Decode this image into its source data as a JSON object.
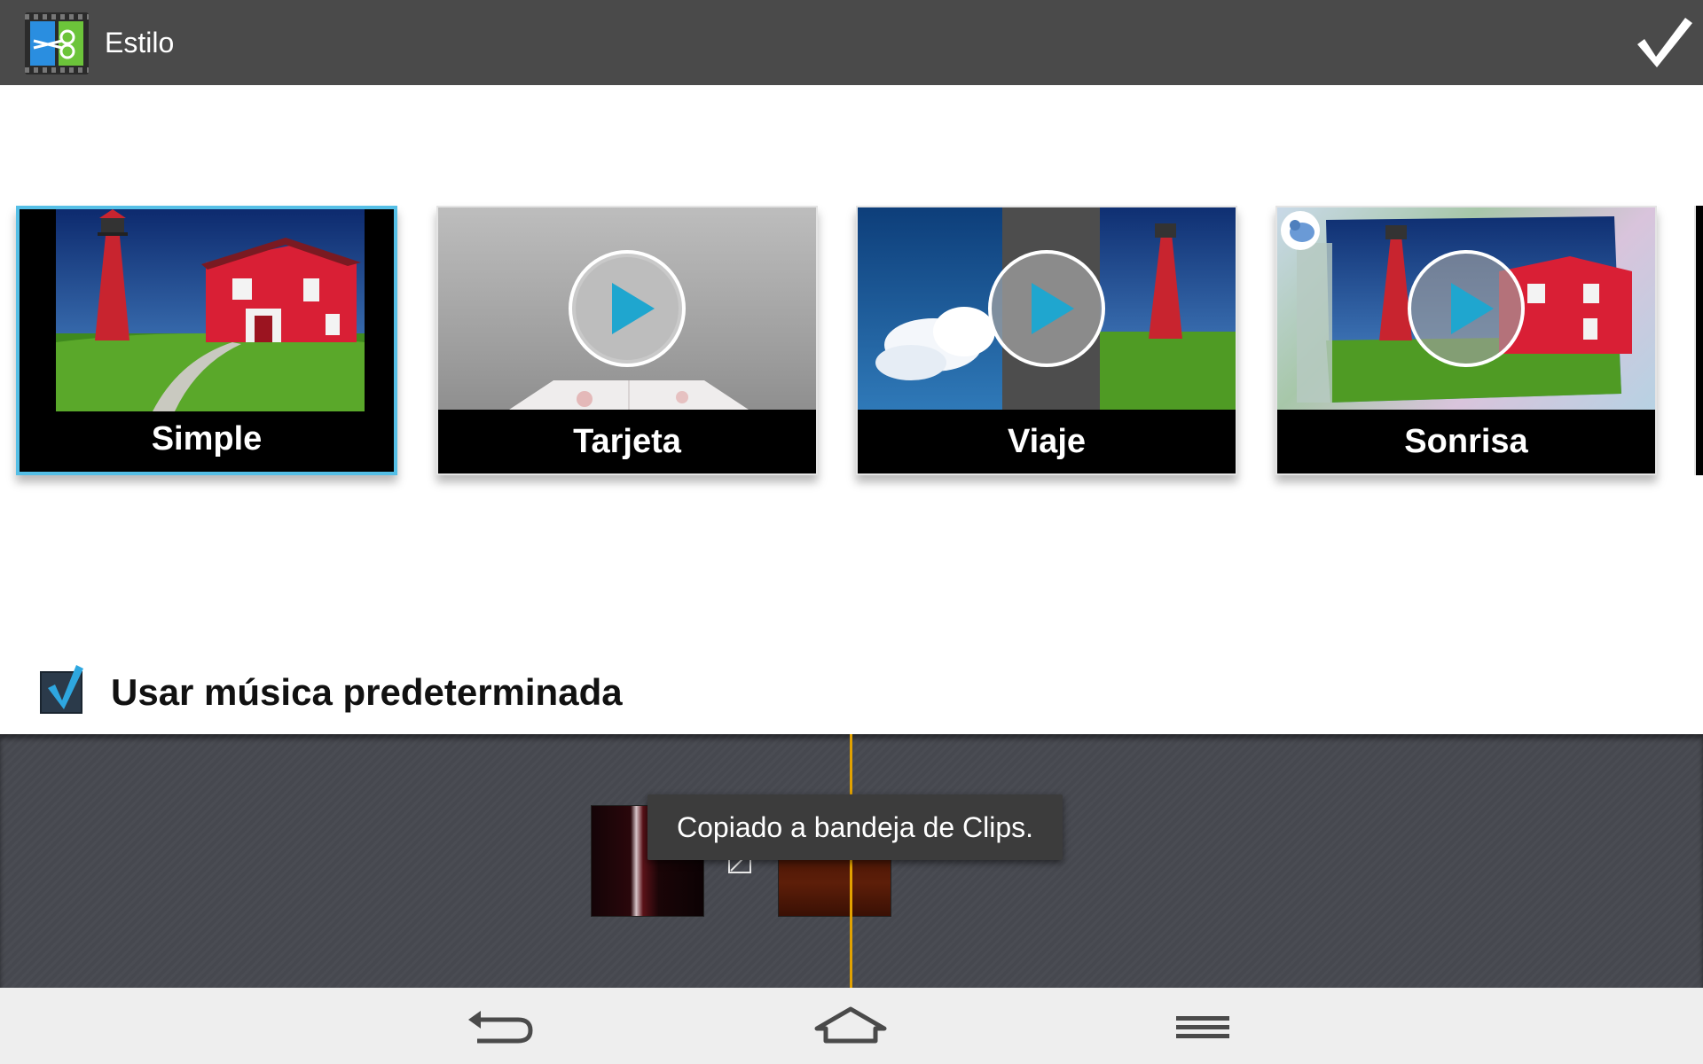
{
  "action_bar": {
    "title": "Estilo",
    "app_icon": "video-editor-app-icon",
    "confirm_icon": "checkmark-icon"
  },
  "styles": [
    {
      "label": "Simple",
      "selected": true,
      "preview": "lighthouse-photo"
    },
    {
      "label": "Tarjeta",
      "selected": false,
      "preview": "card-theme-preview",
      "play_icon": "play-icon"
    },
    {
      "label": "Viaje",
      "selected": false,
      "preview": "travel-theme-preview",
      "play_icon": "play-icon"
    },
    {
      "label": "Sonrisa",
      "selected": false,
      "preview": "smile-theme-preview",
      "play_icon": "play-icon"
    }
  ],
  "music": {
    "label": "Usar música predeterminada",
    "checked": true
  },
  "timeline": {
    "toast": "Copiado a bandeja de Clips.",
    "clip_count": 2
  },
  "nav": {
    "back_icon": "back-icon",
    "home_icon": "home-icon",
    "menu_icon": "menu-icon"
  },
  "colors": {
    "action_bar": "#4a4a4a",
    "selection_border": "#55bfe6",
    "playhead": "#e2a200",
    "timeline_bg": "#46484f"
  }
}
